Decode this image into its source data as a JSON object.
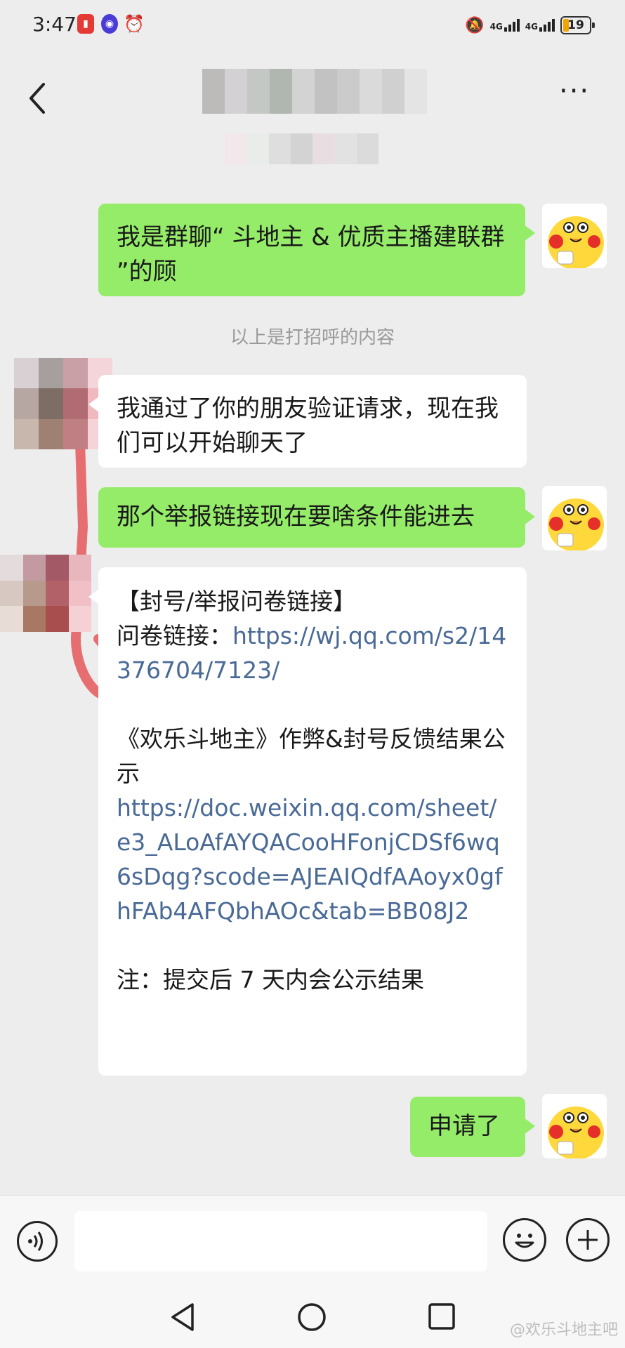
{
  "status_bar": {
    "time": "3:47",
    "network_1": "4G",
    "network_2": "4G",
    "battery": "19"
  },
  "header": {
    "back_icon": "chevron-left-icon",
    "more_label": "···"
  },
  "messages": [
    {
      "side": "me",
      "text": "我是群聊“ 斗地主 & 优质主播建联群 ”的顾"
    },
    {
      "system": "以上是打招呼的内容"
    },
    {
      "side": "them",
      "text": "我通过了你的朋友验证请求，现在我们可以开始聊天了"
    },
    {
      "side": "me",
      "text": "那个举报链接现在要啥条件能进去"
    },
    {
      "side": "them",
      "line1": "【封号/举报问卷链接】",
      "line2_prefix": "问卷链接：",
      "link1": "https://wj.qq.com/s2/14376704/7123/",
      "line3": "《欢乐斗地主》作弊&封号反馈结果公示",
      "link2": "https://doc.weixin.qq.com/sheet/e3_ALoAfAYQACooHFonjCDSf6wq6sDqg?scode=AJEAIQdfAAoyx0gfhFAb4AFQbhAOc&tab=BB08J2",
      "line4": "注：提交后 7 天内会公示结果"
    },
    {
      "side": "me",
      "text": "申请了"
    }
  ],
  "input_bar": {
    "voice_icon": "voice-icon",
    "emoji_icon": "emoji-icon",
    "plus_icon": "plus-icon"
  },
  "system_nav": {
    "back": "back-triangle-icon",
    "home": "home-circle-icon",
    "recents": "recents-square-icon"
  },
  "watermark": "@欢乐斗地主吧"
}
